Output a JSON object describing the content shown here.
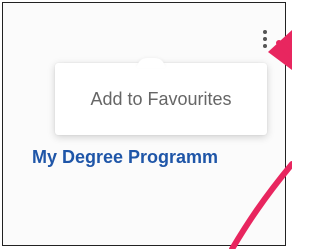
{
  "popup_menu": {
    "items": [
      {
        "label": "Add to Favourites"
      }
    ]
  },
  "card": {
    "title": "My Degree Programm"
  },
  "icons": {
    "menu": "more-vertical-icon",
    "annotation_arrow": "arrow-up-right-icon"
  },
  "colors": {
    "title": "#1f56a8",
    "annotation_arrow": "#e8265f",
    "menu_text": "#666666",
    "card_border": "#222222"
  }
}
